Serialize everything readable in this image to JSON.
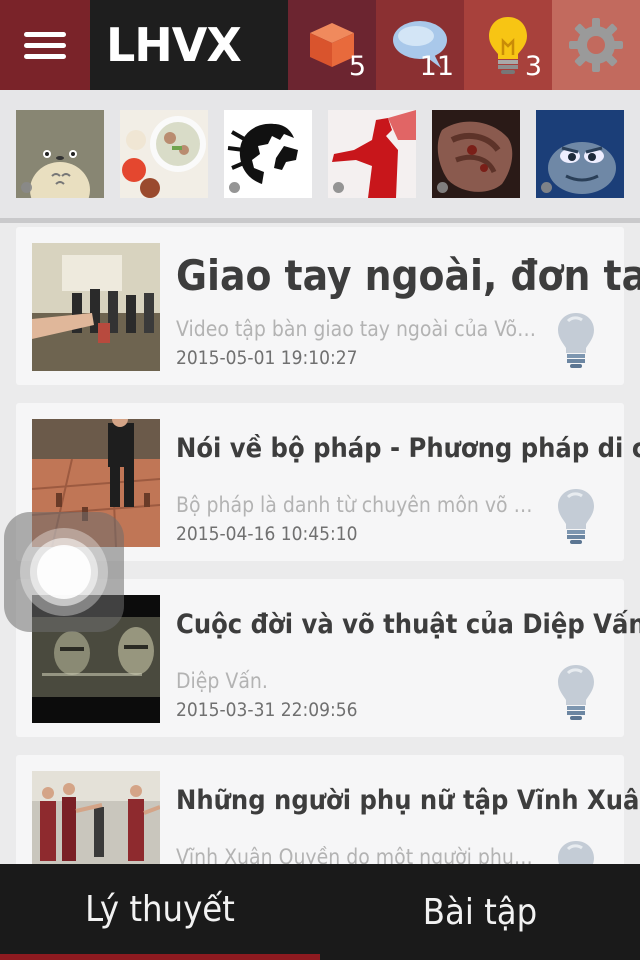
{
  "app": {
    "logo": "LHVX"
  },
  "toolbar": {
    "lessons_count": "5",
    "comments_count": "11",
    "ideas_count": "3"
  },
  "feed": {
    "items": [
      {
        "title": "Giao tay ngoài, đơn tay",
        "description": "Video tập bàn giao tay ngoài của Võ sư…",
        "date": "2015-05-01 19:10:27"
      },
      {
        "title": "Nói về bộ pháp - Phương pháp di chuyển",
        "description": "Bộ pháp là danh từ chuyên môn võ thu…",
        "date": "2015-04-16 10:45:10"
      },
      {
        "title": "Cuộc đời và võ thuật của Diệp Vấn",
        "description": "Diệp Vấn.",
        "date": "2015-03-31 22:09:56"
      },
      {
        "title": "Những người phụ nữ tập Vĩnh Xuân",
        "description": "Vĩnh Xuân Quyền do một người phụ nữ…",
        "date": ""
      }
    ]
  },
  "tabs": {
    "theory": "Lý thuyết",
    "exercises": "Bài tập"
  },
  "colors": {
    "accent": "#8e1a20",
    "header_dark": "#1e1e1e"
  }
}
